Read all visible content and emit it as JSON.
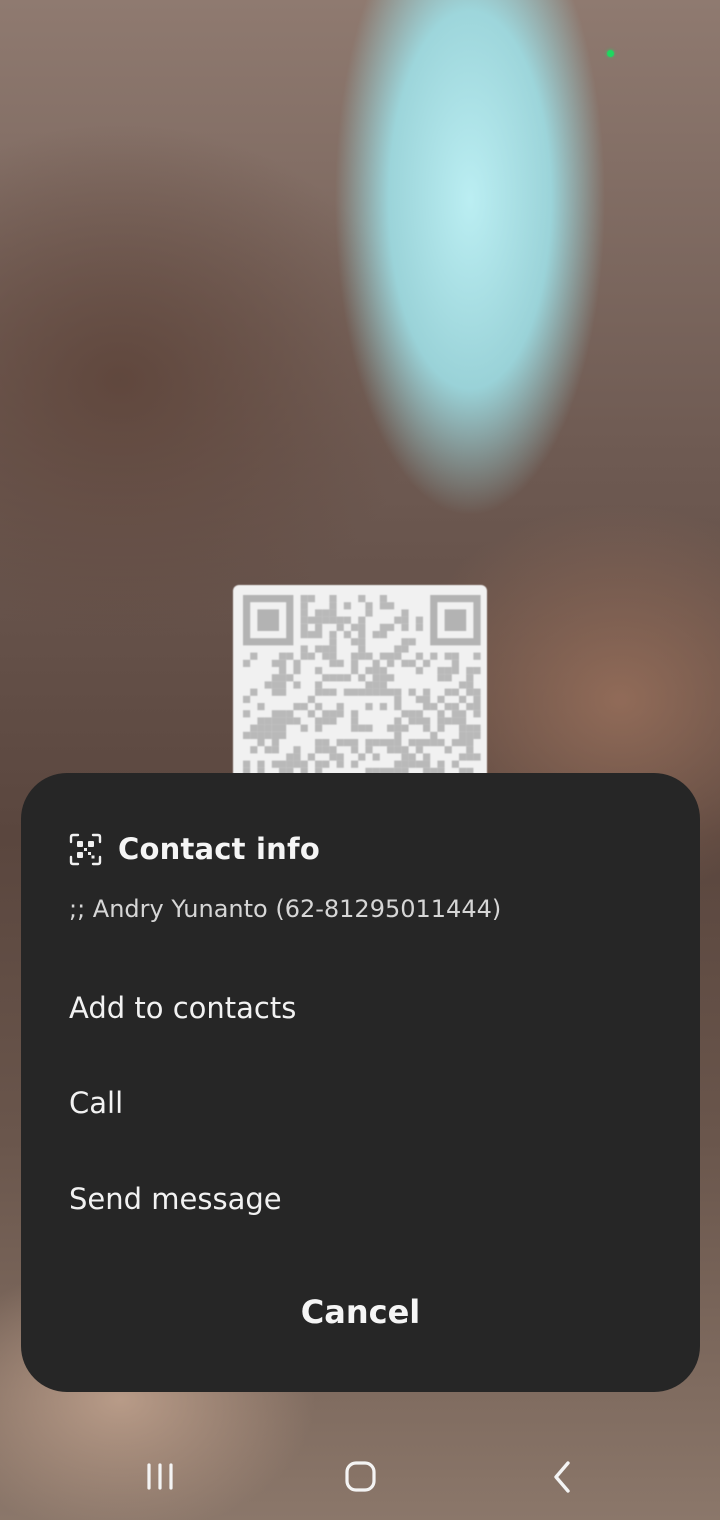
{
  "background": {
    "description_icon": "camera-viewfinder",
    "status_dot_color": "#1ed760"
  },
  "sheet": {
    "icon": "qr-code-icon",
    "title": "Contact info",
    "contact": ";; Andry Yunanto (62-81295011444)",
    "actions": [
      {
        "label": "Add to contacts"
      },
      {
        "label": "Call"
      },
      {
        "label": "Send message"
      }
    ],
    "cancel_label": "Cancel"
  },
  "navigation": {
    "recents_icon": "recents-icon",
    "home_icon": "home-icon",
    "back_icon": "back-icon"
  },
  "colors": {
    "sheet_bg": "#262626",
    "text": "#f2f2f2"
  }
}
